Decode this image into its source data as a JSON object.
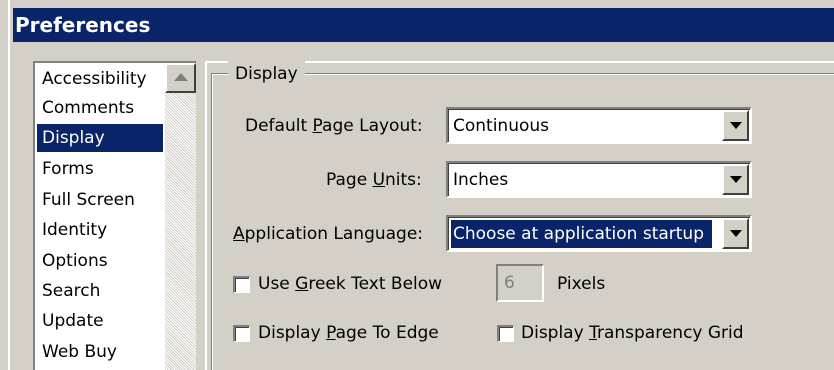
{
  "window": {
    "title": "Preferences"
  },
  "categories": {
    "items": [
      "Accessibility",
      "Comments",
      "Display",
      "Forms",
      "Full Screen",
      "Identity",
      "Options",
      "Search",
      "Update",
      "Web Buy"
    ],
    "selected": "Display"
  },
  "display_group": {
    "title": "Display",
    "default_page_layout": {
      "label_pre": "Default ",
      "label_u": "P",
      "label_post": "age Layout:",
      "value": "Continuous"
    },
    "page_units": {
      "label_pre": "Page ",
      "label_u": "U",
      "label_post": "nits:",
      "value": "Inches"
    },
    "application_language": {
      "label_pre": "",
      "label_u": "A",
      "label_post": "pplication Language:",
      "value": "Choose at application startup"
    },
    "greek_text": {
      "label_pre": "Use ",
      "label_u": "G",
      "label_post": "reek Text Below",
      "checked": false,
      "pixels_value": "6",
      "pixels_label": "Pixels"
    },
    "page_to_edge": {
      "label_pre": "Display ",
      "label_u": "P",
      "label_post": "age To Edge",
      "checked": false
    },
    "transparency_grid": {
      "label_pre": "Display ",
      "label_u": "T",
      "label_post": "ransparency Grid",
      "checked": false
    }
  },
  "colors": {
    "selection": "#0a246a",
    "face": "#d4d0c8"
  },
  "icons": {
    "scroll_up": "triangle-up-icon",
    "dropdown": "triangle-down-icon"
  }
}
